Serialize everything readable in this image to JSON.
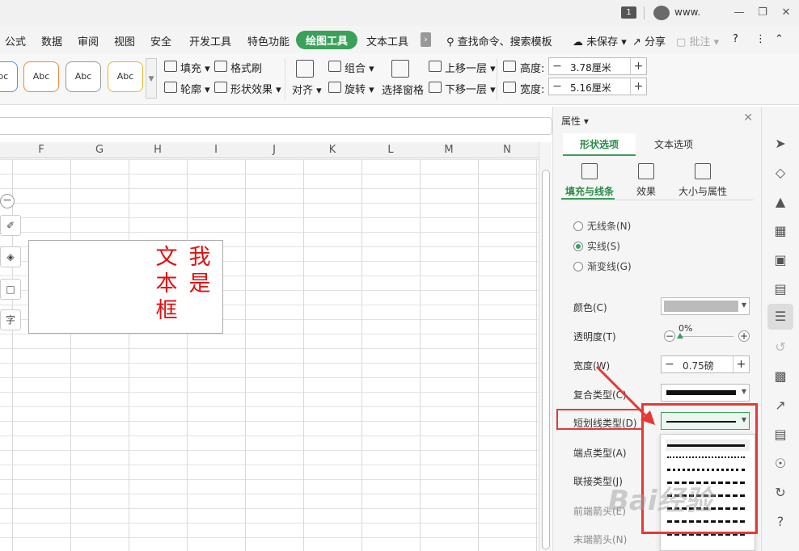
{
  "titlebar": {
    "badge": "1",
    "user": "www."
  },
  "menu": {
    "tabs": [
      "公式",
      "数据",
      "审阅",
      "视图",
      "安全",
      "开发工具",
      "特色功能",
      "绘图工具",
      "文本工具"
    ],
    "active_tab": "绘图工具",
    "search": "查找命令、搜索模板",
    "unsaved": "未保存",
    "share": "分享",
    "comment": "批注",
    "help": "?"
  },
  "ribbon": {
    "style_boxes": [
      "Abc",
      "Abc",
      "Abc",
      "Abc"
    ],
    "fill": "填充",
    "format_brush": "格式刷",
    "outline": "轮廓",
    "shape_effect": "形状效果",
    "align": "对齐",
    "group": "组合",
    "rotate": "旋转",
    "selection_pane": "选择窗格",
    "bring_forward": "上移一层",
    "send_backward": "下移一层",
    "height_label": "高度:",
    "height_value": "3.78厘米",
    "width_label": "宽度:",
    "width_value": "5.16厘米"
  },
  "sheet": {
    "columns": [
      "F",
      "G",
      "H",
      "I",
      "J",
      "K",
      "L",
      "M",
      "N"
    ],
    "textbox_col1": "我是",
    "textbox_col2": "文本框",
    "float_text_tool": "字"
  },
  "panel": {
    "title": "属性",
    "tab_shape": "形状选项",
    "tab_text": "文本选项",
    "sub_fill": "填充与线条",
    "sub_effect": "效果",
    "sub_size": "大小与属性",
    "radio_none": "无线条(N)",
    "radio_solid": "实线(S)",
    "radio_gradient": "渐变线(G)",
    "color_label": "颜色(C)",
    "transparency_label": "透明度(T)",
    "transparency_value": "0%",
    "width_label": "宽度(W)",
    "width_value": "0.75磅",
    "compound_label": "复合类型(C)",
    "dash_label": "短划线类型(D)",
    "cap_label": "端点类型(A)",
    "join_label": "联接类型(J)",
    "begin_arrow_label": "前端箭头(E)",
    "end_arrow_label": "末端箭头(N)"
  },
  "colors": {
    "accent": "#3aa05a",
    "annotation": "#e53935",
    "textbox_text": "#e01010"
  }
}
